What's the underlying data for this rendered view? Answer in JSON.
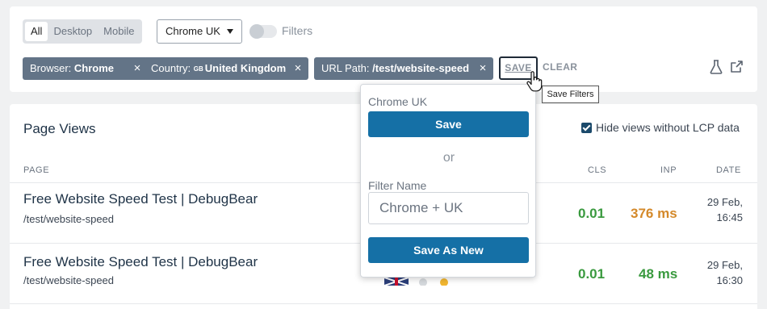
{
  "filters": {
    "device_tabs": [
      "All",
      "Desktop",
      "Mobile"
    ],
    "active_tab": "All",
    "saved_filter_select": "Chrome UK",
    "toggle_label": "Filters",
    "chips": [
      {
        "key": "Browser:",
        "value": "Chrome"
      },
      {
        "key": "Country:",
        "flag": "GB",
        "value": "United Kingdom"
      },
      {
        "key": "URL Path:",
        "value": "/test/website-speed"
      }
    ],
    "chip_remove_glyph": "×",
    "save_label": "SAVE",
    "clear_label": "CLEAR"
  },
  "page_views": {
    "title": "Page Views",
    "hide_lcp_label": "Hide views without LCP data",
    "hide_lcp_checked": true,
    "columns": {
      "page": "PAGE",
      "cls": "CLS",
      "inp": "INP",
      "date": "DATE"
    },
    "rows": [
      {
        "title": "Free Website Speed Test | DebugBear",
        "url": "/test/website-speed",
        "cls": "0.01",
        "inp": "376 ms",
        "inp_status": "warning",
        "date_line1": "29 Feb,",
        "date_line2": "16:45"
      },
      {
        "title": "Free Website Speed Test | DebugBear",
        "url": "/test/website-speed",
        "cls": "0.01",
        "inp": "48 ms",
        "inp_status": "good",
        "date_line1": "29 Feb,",
        "date_line2": "16:30"
      }
    ]
  },
  "save_popup": {
    "saved_name": "Chrome UK",
    "save_button": "Save",
    "or_text": "or",
    "filter_name_label": "Filter Name",
    "filter_name_placeholder": "Chrome + UK",
    "save_as_new_button": "Save As New"
  },
  "tooltip": "Save Filters",
  "colors": {
    "chip_bg": "#637487",
    "primary_button": "#1570a6",
    "good": "#3a9a3f",
    "warning": "#d4892a"
  },
  "icons": [
    "close-icon",
    "flask-icon",
    "external-link-icon",
    "checkbox-icon",
    "hand-cursor-icon",
    "caret-down-icon"
  ]
}
